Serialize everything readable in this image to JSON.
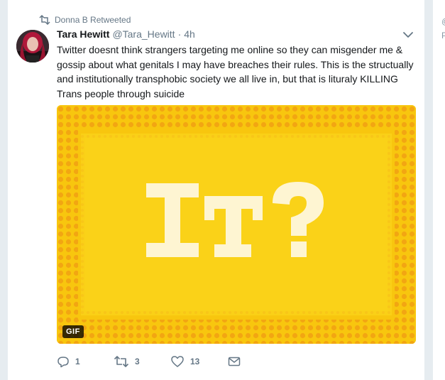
{
  "retweet_context": {
    "text": "Donna B Retweeted",
    "icon": "retweet-icon"
  },
  "tweet": {
    "author_name": "Tara Hewitt",
    "author_handle": "@Tara_Hewitt",
    "separator": "·",
    "timestamp": "4h",
    "text": "Twitter doesnt think strangers targeting me online so they can misgender me & gossip about what genitals I may have breaches their rules. This is the structually and institutionally transphobic society we all live in, but that is lituraly KILLING Trans people through suicide",
    "media": {
      "caption_text": "IT?",
      "badge": "GIF",
      "background_color": "#f8c60e",
      "pattern_color": "#f2a612"
    }
  },
  "actions": {
    "reply_count": "1",
    "retweet_count": "3",
    "like_count": "13"
  },
  "side_panel": {
    "fragment_1": "@",
    "fragment_2": "P"
  },
  "colors": {
    "text_primary": "#14171a",
    "text_secondary": "#657786",
    "background": "#e6ecf0"
  }
}
